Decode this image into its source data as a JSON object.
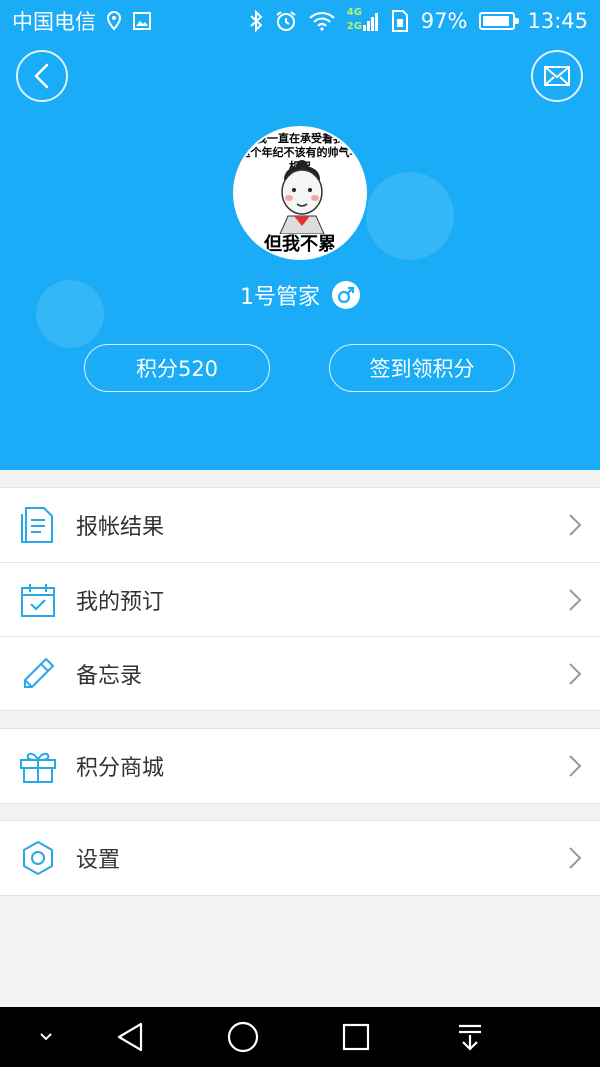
{
  "statusbar": {
    "carrier": "中国电信",
    "network_top": "4G",
    "network_bottom": "2G",
    "battery": "97%",
    "time": "13:45"
  },
  "profile": {
    "avatar_caption_top": "我一直在承受着我\n这个年纪不该有的帅气与机智",
    "avatar_caption_bottom": "但我不累",
    "username": "1号管家",
    "gender_icon": "male-icon",
    "points_label": "积分520",
    "checkin_label": "签到领积分"
  },
  "menu": {
    "group1": [
      {
        "label": "报帐结果",
        "icon": "document-icon"
      },
      {
        "label": "我的预订",
        "icon": "calendar-check-icon"
      },
      {
        "label": "备忘录",
        "icon": "pencil-icon"
      }
    ],
    "group2": [
      {
        "label": "积分商城",
        "icon": "gift-icon"
      }
    ],
    "group3": [
      {
        "label": "设置",
        "icon": "settings-icon"
      }
    ]
  },
  "colors": {
    "header": "#1aacf6",
    "icon": "#29a8e8",
    "background": "#f2f2f2"
  }
}
